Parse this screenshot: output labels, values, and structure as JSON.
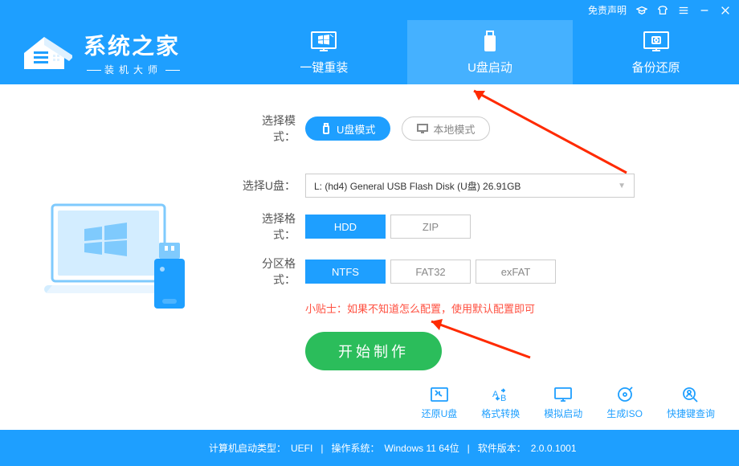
{
  "titlebar": {
    "disclaimer": "免责声明"
  },
  "brand": {
    "title": "系统之家",
    "subtitle": "装机大师"
  },
  "tabs": {
    "reinstall": "一键重装",
    "usbboot": "U盘启动",
    "backup": "备份还原"
  },
  "labels": {
    "mode": "选择模式：",
    "drive": "选择U盘：",
    "bootfmt": "选择格式：",
    "partfmt": "分区格式："
  },
  "mode": {
    "usb": "U盘模式",
    "local": "本地模式"
  },
  "drive": {
    "value": "L: (hd4) General USB Flash Disk (U盘) 26.91GB"
  },
  "bootfmt": {
    "hdd": "HDD",
    "zip": "ZIP"
  },
  "partfmt": {
    "ntfs": "NTFS",
    "fat32": "FAT32",
    "exfat": "exFAT"
  },
  "hint": "小贴士：如果不知道怎么配置，使用默认配置即可",
  "primary": "开始制作",
  "tools": {
    "restore": "还原U盘",
    "convert": "格式转换",
    "simboot": "模拟启动",
    "geniso": "生成ISO",
    "hotkey": "快捷键查询"
  },
  "status": {
    "boot_label": "计算机启动类型：",
    "boot_value": "UEFI",
    "os_label": "操作系统：",
    "os_value": "Windows 11 64位",
    "ver_label": "软件版本：",
    "ver_value": "2.0.0.1001"
  }
}
